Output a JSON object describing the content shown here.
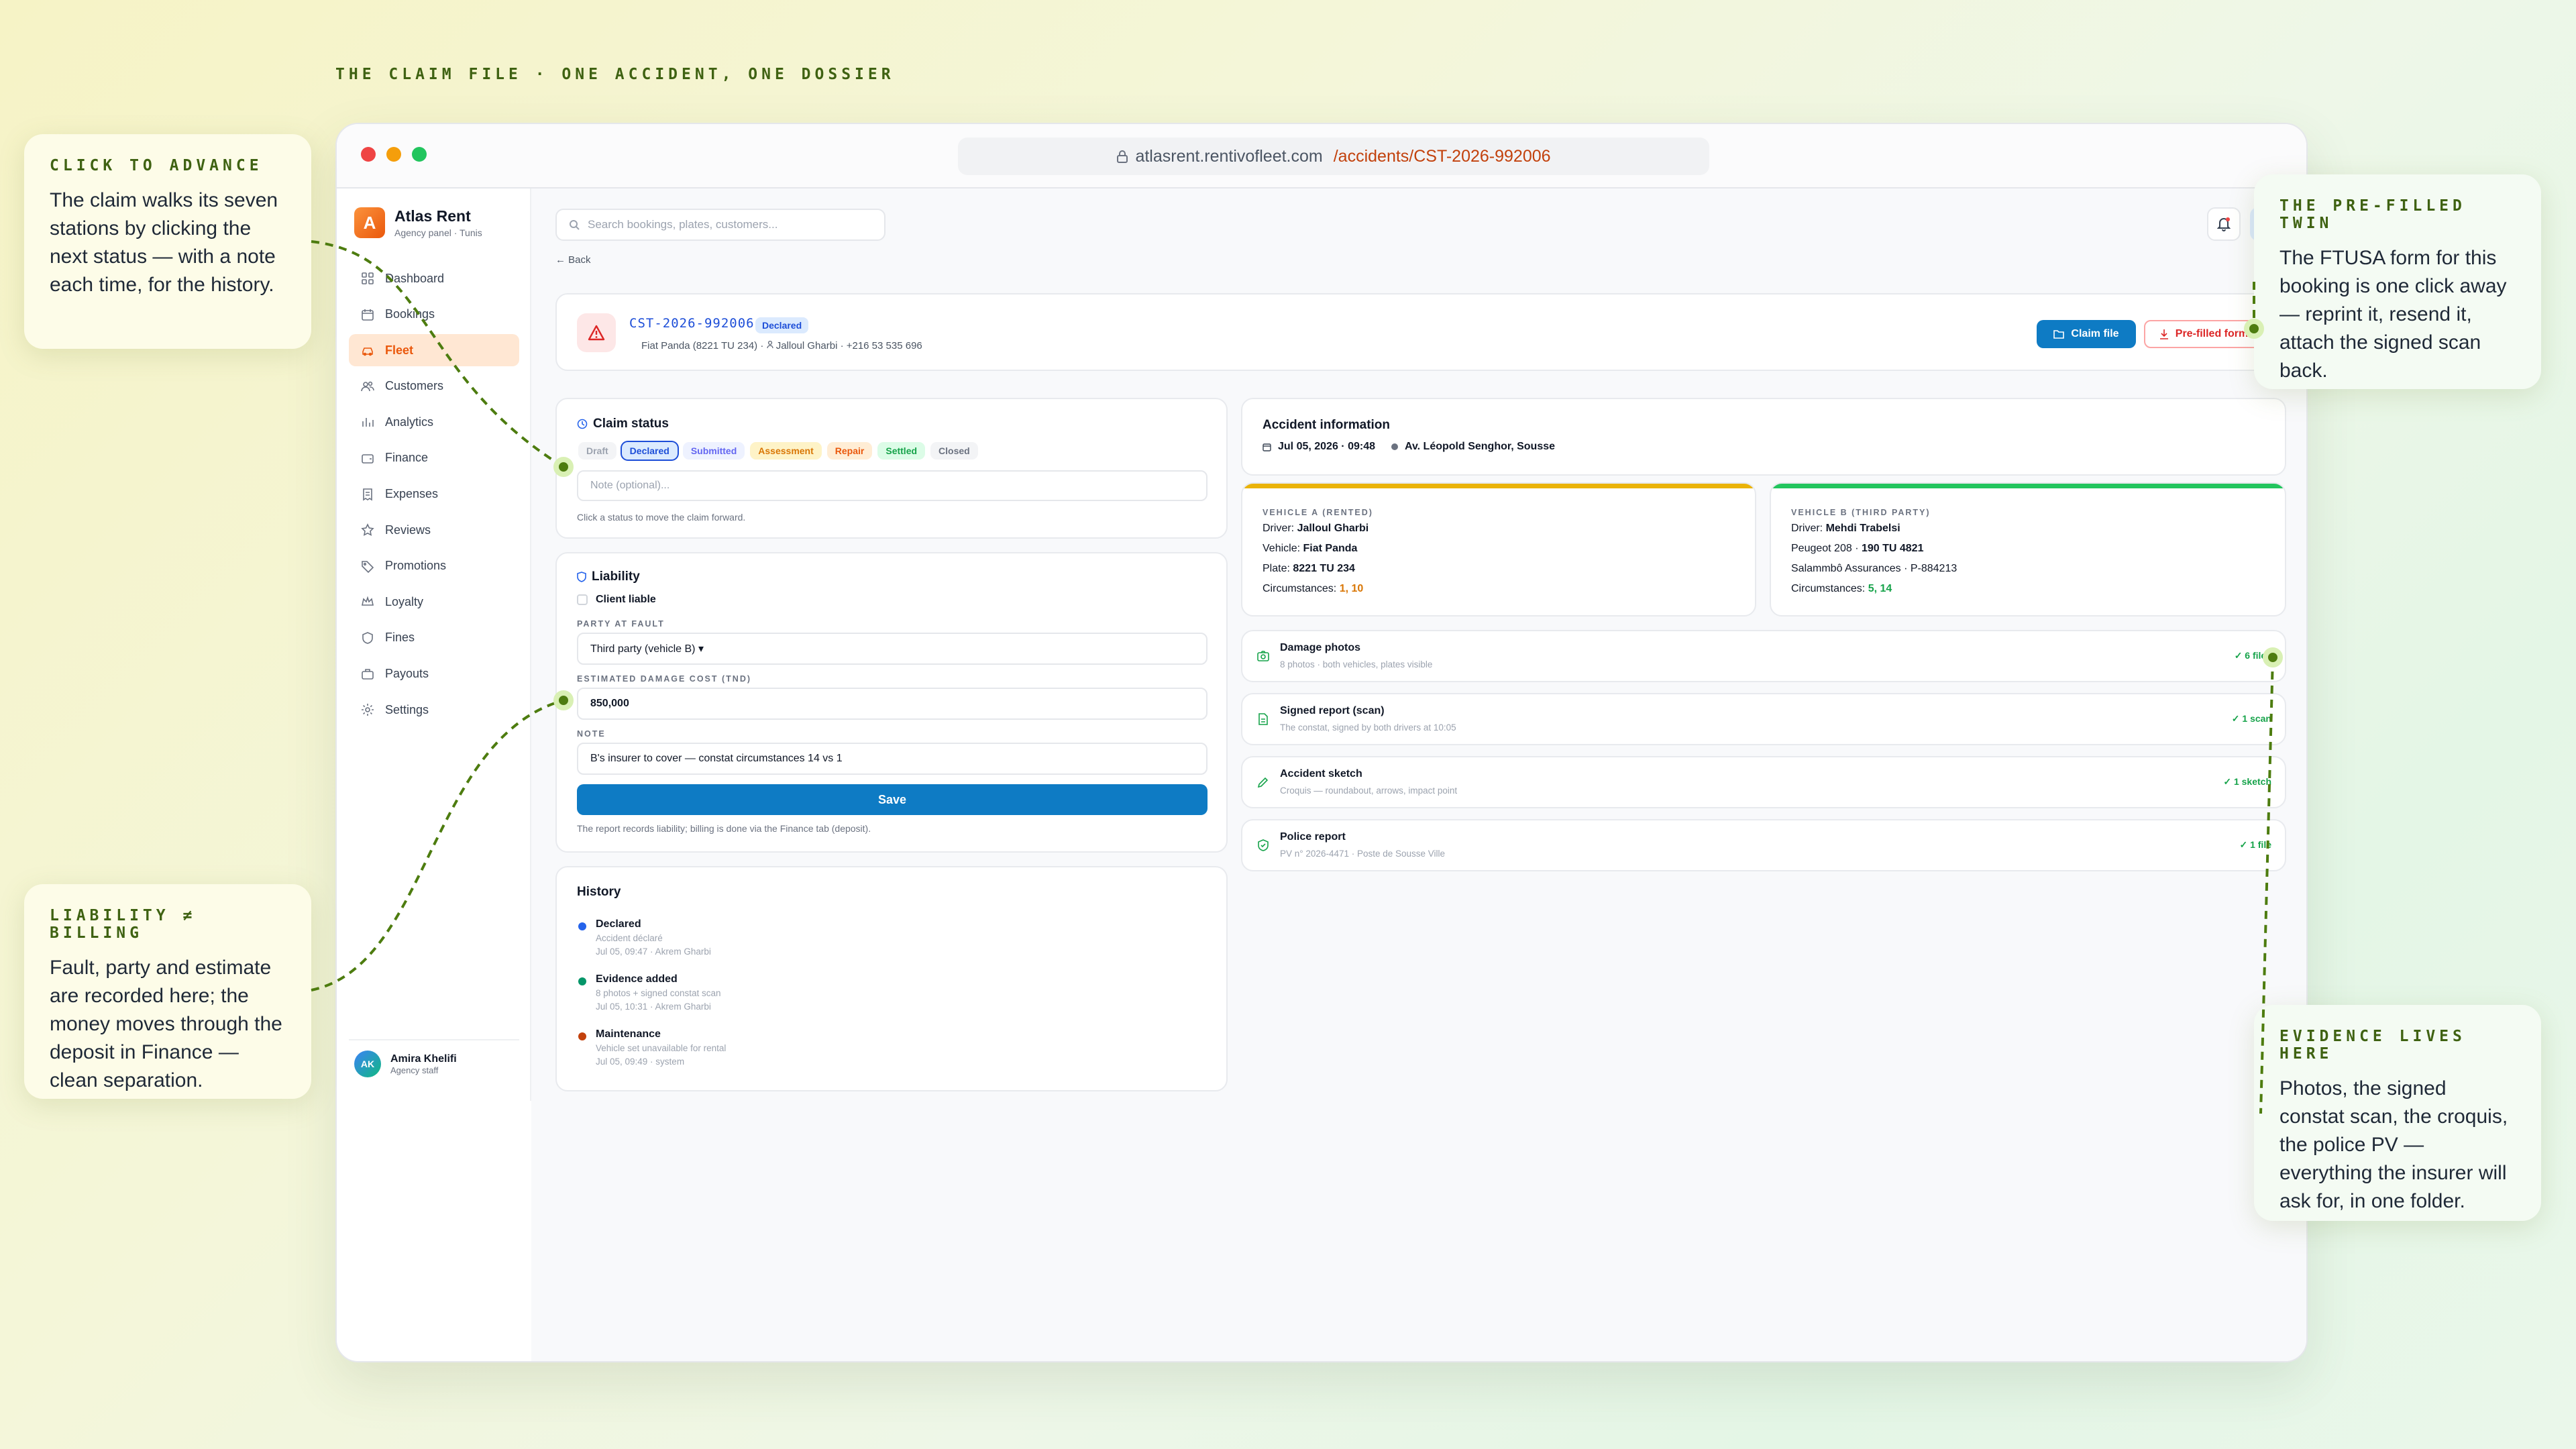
{
  "page": {
    "eyebrow": "THE CLAIM FILE · ONE ACCIDENT, ONE DOSSIER"
  },
  "browser": {
    "domain": "atlasrent.rentivofleet.com",
    "path": "/accidents/CST-2026-992006"
  },
  "brand": {
    "name": "Atlas Rent",
    "sub": "Agency panel · Tunis",
    "logo_letter": "A",
    "accent": "#ea580c"
  },
  "sidebar": {
    "items": [
      {
        "label": "Dashboard",
        "icon": "grid-icon"
      },
      {
        "label": "Bookings",
        "icon": "calendar-icon"
      },
      {
        "label": "Fleet",
        "icon": "car-icon",
        "active": true
      },
      {
        "label": "Customers",
        "icon": "users-icon"
      },
      {
        "label": "Analytics",
        "icon": "chart-icon"
      },
      {
        "label": "Finance",
        "icon": "wallet-icon"
      },
      {
        "label": "Expenses",
        "icon": "receipt-icon"
      },
      {
        "label": "Reviews",
        "icon": "star-icon"
      },
      {
        "label": "Promotions",
        "icon": "tag-icon"
      },
      {
        "label": "Loyalty",
        "icon": "crown-icon"
      },
      {
        "label": "Fines",
        "icon": "shield-icon"
      },
      {
        "label": "Payouts",
        "icon": "briefcase-icon"
      },
      {
        "label": "Settings",
        "icon": "gear-icon"
      }
    ],
    "user": {
      "initials": "AK",
      "name": "Amira Khelifi",
      "role": "Agency staff"
    }
  },
  "topbar": {
    "search_placeholder": "Search bookings, plates, customers...",
    "user_initials": "AK"
  },
  "back_label": "Back",
  "claim": {
    "id": "CST-2026-992006",
    "status_badge": "Declared",
    "vehicle": "Fiat Panda (8221 TU 234)",
    "customer": "Jalloul Gharbi · +216 53 535 696",
    "claim_file_label": "Claim file",
    "prefilled_label": "Pre-filled form"
  },
  "claim_status": {
    "title": "Claim status",
    "chips": [
      {
        "label": "Draft",
        "color": "#9ca3af",
        "bg": "#f3f4f6"
      },
      {
        "label": "Declared",
        "color": "#1d4ed8",
        "bg": "#dbeafe",
        "active": true
      },
      {
        "label": "Submitted",
        "color": "#6366f1",
        "bg": "#eef2ff"
      },
      {
        "label": "Assessment",
        "color": "#d97706",
        "bg": "#fef3c7"
      },
      {
        "label": "Repair",
        "color": "#ea580c",
        "bg": "#ffedd5"
      },
      {
        "label": "Settled",
        "color": "#16a34a",
        "bg": "#dcfce7"
      },
      {
        "label": "Closed",
        "color": "#6b7280",
        "bg": "#f3f4f6"
      }
    ],
    "note_placeholder": "Note (optional)...",
    "help": "Click a status to move the claim forward."
  },
  "liability": {
    "title": "Liability",
    "client_liable_label": "Client liable",
    "party_label": "PARTY AT FAULT",
    "party_value": "Third party (vehicle B) ▾",
    "cost_label": "ESTIMATED DAMAGE COST (TND)",
    "cost_value": "850,000",
    "note_label": "NOTE",
    "note_value": "B's insurer to cover — constat circumstances 14 vs 1",
    "save_label": "Save",
    "help": "The report records liability; billing is done via the Finance tab (deposit)."
  },
  "history": {
    "title": "History",
    "items": [
      {
        "title": "Declared",
        "sub": "Accident déclaré",
        "meta": "Jul 05, 09:47 · Akrem Gharbi",
        "color": "#2563eb"
      },
      {
        "title": "Evidence added",
        "sub": "8 photos + signed constat scan",
        "meta": "Jul 05, 10:31 · Akrem Gharbi",
        "color": "#059669"
      },
      {
        "title": "Maintenance",
        "sub": "Vehicle set unavailable for rental",
        "meta": "Jul 05, 09:49 · system",
        "color": "#c2410c"
      }
    ]
  },
  "accident": {
    "title": "Accident information",
    "datetime": "Jul 05, 2026 · 09:48",
    "location": "Av. Léopold Senghor, Sousse"
  },
  "vehicle_a": {
    "label": "VEHICLE A (RENTED)",
    "driver_label": "Driver:",
    "driver": "Jalloul Gharbi",
    "vehicle_label": "Vehicle:",
    "vehicle": "Fiat Panda",
    "plate_label": "Plate:",
    "plate": "8221 TU 234",
    "circ_label": "Circumstances:",
    "circ": "1, 10",
    "color": "#eab308"
  },
  "vehicle_b": {
    "label": "VEHICLE B (THIRD PARTY)",
    "driver_label": "Driver:",
    "driver": "Mehdi Trabelsi",
    "vehicle_prefix": "Peugeot 208 · ",
    "plate": "190 TU 4821",
    "insurer": "Salammbô Assurances · P-884213",
    "circ_label": "Circumstances:",
    "circ": "5, 14",
    "color": "#22c55e"
  },
  "evidence": [
    {
      "title": "Damage photos",
      "sub": "8 photos · both vehicles, plates visible",
      "count": "✓ 6 files",
      "icon": "camera-icon"
    },
    {
      "title": "Signed report (scan)",
      "sub": "The constat, signed by both drivers at 10:05",
      "count": "✓ 1 scan",
      "icon": "document-icon"
    },
    {
      "title": "Accident sketch",
      "sub": "Croquis — roundabout, arrows, impact point",
      "count": "✓ 1 sketch",
      "icon": "pencil-icon"
    },
    {
      "title": "Police report",
      "sub": "PV n° 2026-4471 · Poste de Sousse Ville",
      "count": "✓ 1 file",
      "icon": "shield-check-icon"
    }
  ],
  "callouts": {
    "advance": {
      "title": "CLICK TO ADVANCE",
      "body": "The claim walks its seven stations by clicking the next status — with a note each time, for the history."
    },
    "liability": {
      "title": "LIABILITY ≠ BILLING",
      "body": "Fault, party and estimate are recorded here; the money moves through the deposit in Finance — clean separation."
    },
    "twin": {
      "title": "THE PRE-FILLED TWIN",
      "body": "The FTUSA form for this booking is one click away — reprint it, resend it, attach the signed scan back."
    },
    "evidence": {
      "title": "EVIDENCE LIVES HERE",
      "body": "Photos, the signed constat scan, the croquis, the police PV — everything the insurer will ask for, in one folder."
    }
  }
}
